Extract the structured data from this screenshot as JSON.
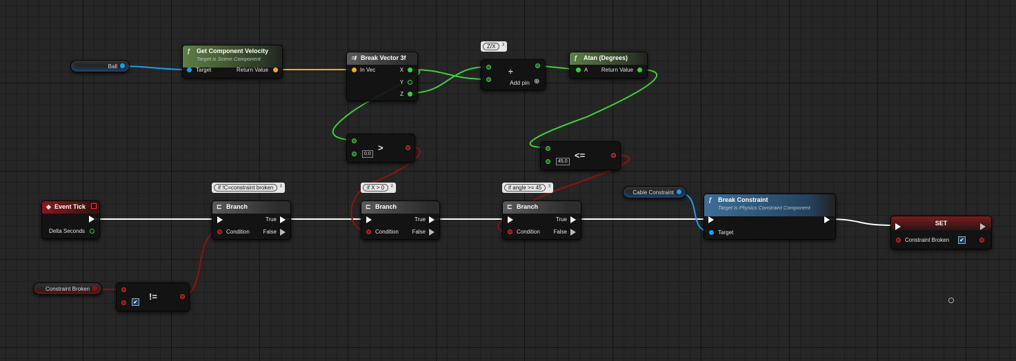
{
  "colors": {
    "exec": "#ffffff",
    "vector": "#f3b100",
    "float": "#3cd13c",
    "bool": "#8e1212",
    "object": "#1d9ff0"
  },
  "variables": {
    "ball": "Ball",
    "constraint_broken": "Constraint Broken",
    "cable_constraint": "Cable Constraint"
  },
  "get_velocity": {
    "title": "Get Component Velocity",
    "subtitle": "Target is Scene Component",
    "target": "Target",
    "return_value": "Return Value",
    "icon": "function-icon"
  },
  "break_vector": {
    "title": "Break Vector 3f",
    "in_vec": "In Vec",
    "x": "X",
    "y": "Y",
    "z": "Z",
    "icon": "break-struct-icon"
  },
  "divide": {
    "comment": "Z/X",
    "op": "÷",
    "add_pin": "Add pin",
    "add_icon": "⊕"
  },
  "atan": {
    "title": "Atan (Degrees)",
    "a": "A",
    "return_value": "Return Value",
    "icon": "function-icon"
  },
  "greater": {
    "op": ">",
    "value": "0.0"
  },
  "less_equal": {
    "op": "<=",
    "value": "45.0"
  },
  "event_tick": {
    "title": "Event Tick",
    "delta_seconds": "Delta Seconds",
    "icon": "event-diamond-icon"
  },
  "branches": [
    {
      "comment": "if !C=constraint broken",
      "title": "Branch",
      "condition": "Condition",
      "true": "True",
      "false": "False"
    },
    {
      "comment": "if X > 0",
      "title": "Branch",
      "condition": "Condition",
      "true": "True",
      "false": "False"
    },
    {
      "comment": "if angle >= 45",
      "title": "Branch",
      "condition": "Condition",
      "true": "True",
      "false": "False"
    }
  ],
  "not_equal": {
    "op": "!=",
    "checked": true
  },
  "break_constraint": {
    "title": "Break Constraint",
    "subtitle": "Target is Physics Constraint Component",
    "target": "Target",
    "icon": "function-icon"
  },
  "set_node": {
    "title": "SET",
    "var": "Constraint Broken",
    "checked": true
  },
  "comment_pin_icon": "pin-icon",
  "comment_pin_glyph": "⊼"
}
